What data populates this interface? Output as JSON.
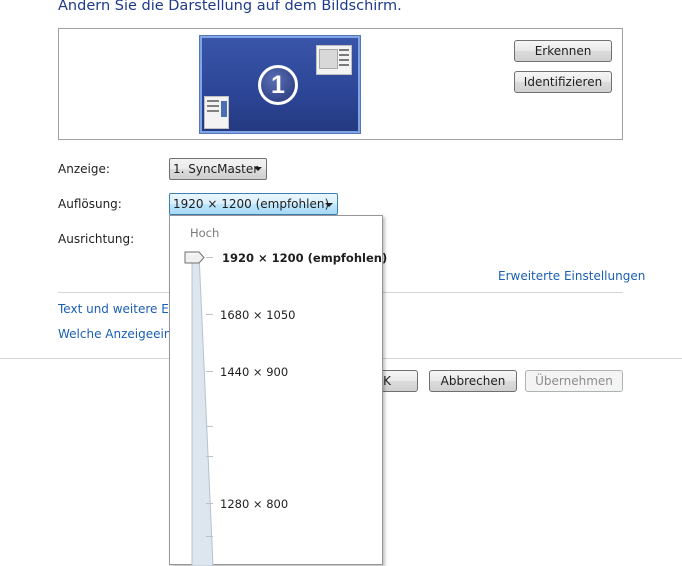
{
  "page": {
    "title": "Ändern Sie die Darstellung auf dem Bildschirm."
  },
  "preview": {
    "monitor_number": "1",
    "detect_label": "Erkennen",
    "identify_label": "Identifizieren"
  },
  "form": {
    "display_label": "Anzeige:",
    "display_value": "1. SyncMaster",
    "resolution_label": "Auflösung:",
    "resolution_value": "1920 × 1200 (empfohlen)",
    "orientation_label": "Ausrichtung:"
  },
  "links": {
    "advanced": "Erweiterte Einstellungen",
    "text_size": "Text und weitere Elen",
    "which_settings": "Welche Anzeigeeinste"
  },
  "buttons": {
    "ok": "K",
    "cancel": "Abbrechen",
    "apply": "Übernehmen"
  },
  "resolution_dropdown": {
    "high_label": "Hoch",
    "options": [
      "1920 × 1200 (empfohlen)",
      "1680 × 1050",
      "1440 × 900",
      "1280 × 800"
    ],
    "selected_index": 0
  },
  "icons": {
    "dropdown_arrow": "chevron-down-icon",
    "slider_thumb": "slider-thumb-icon"
  }
}
